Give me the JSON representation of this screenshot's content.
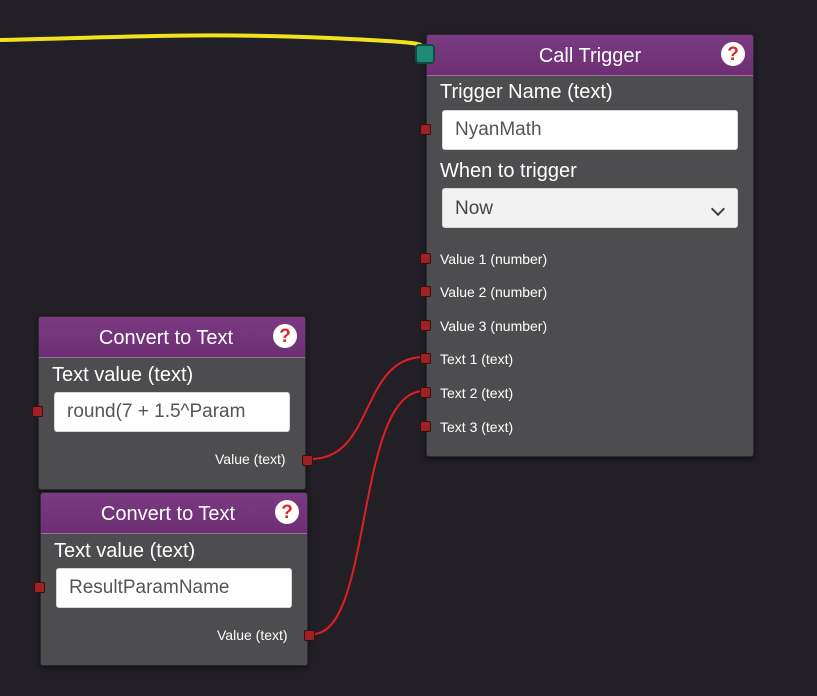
{
  "colors": {
    "background": "#221f27",
    "node_body": "#4d4d4f",
    "node_header": "#7b3a82",
    "exec_wire": "#f3e21a",
    "data_wire": "#e01e24",
    "data_port": "#9e2224",
    "exec_port": "#1f8a78",
    "help_icon": "#e0282d"
  },
  "call_trigger": {
    "title": "Call Trigger",
    "help_icon": "question-mark-icon",
    "trigger_name_label": "Trigger Name (text)",
    "trigger_name_value": "NyanMath",
    "when_label": "When to trigger",
    "when_value": "Now",
    "inputs": [
      "Value 1 (number)",
      "Value 2 (number)",
      "Value 3 (number)",
      "Text 1 (text)",
      "Text 2 (text)",
      "Text 3 (text)"
    ]
  },
  "convert_nodes": [
    {
      "title": "Convert to Text",
      "help_icon": "question-mark-icon",
      "field_label": "Text value (text)",
      "field_value": "round(7 + 1.5^Param",
      "output_label": "Value (text)"
    },
    {
      "title": "Convert to Text",
      "help_icon": "question-mark-icon",
      "field_label": "Text value (text)",
      "field_value": "ResultParamName",
      "output_label": "Value (text)"
    }
  ]
}
